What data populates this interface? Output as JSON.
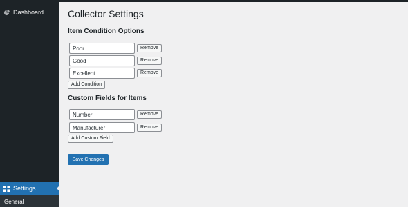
{
  "sidebar": {
    "dashboard_label": "Dashboard",
    "settings_label": "Settings",
    "submenu_general": "General"
  },
  "page": {
    "title": "Collector Settings"
  },
  "conditions": {
    "heading": "Item Condition Options",
    "items": [
      {
        "value": "Poor",
        "remove_label": "Remove"
      },
      {
        "value": "Good",
        "remove_label": "Remove"
      },
      {
        "value": "Excellent",
        "remove_label": "Remove"
      }
    ],
    "add_label": "Add Condition"
  },
  "custom_fields": {
    "heading": "Custom Fields for Items",
    "items": [
      {
        "value": "Number",
        "remove_label": "Remove"
      },
      {
        "value": "Manufacturer",
        "remove_label": "Remove"
      }
    ],
    "add_label": "Add Custom Field"
  },
  "save_label": "Save Changes",
  "colors": {
    "sidebar_bg": "#1d2327",
    "accent": "#2271b1",
    "page_bg": "#f0f0f1"
  },
  "icons": {
    "dashboard": "dashboard-icon",
    "settings": "settings-icon"
  }
}
